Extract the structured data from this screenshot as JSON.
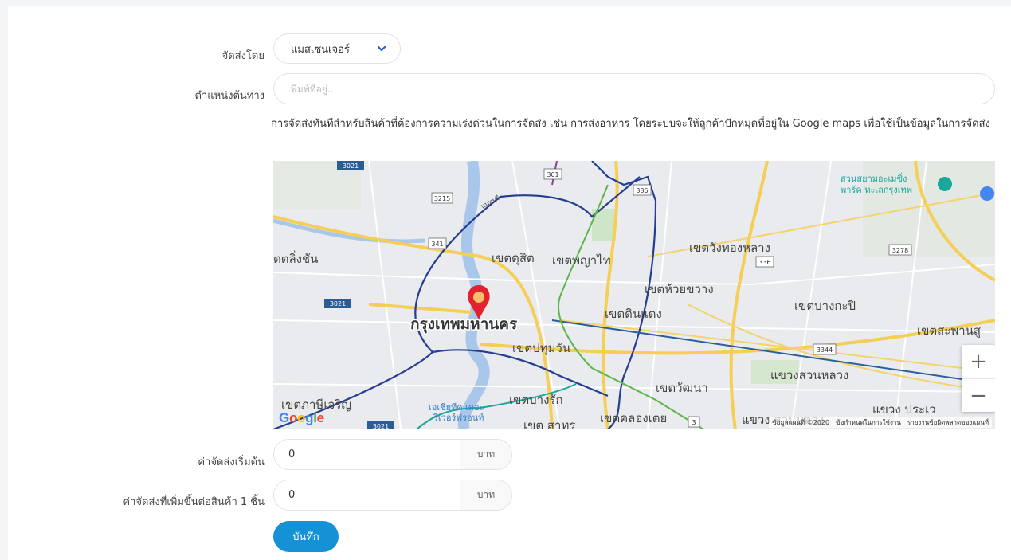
{
  "form": {
    "ship_by_label": "จัดส่งโดย",
    "ship_by_value": "แมสเซนเจอร์",
    "origin_label": "ตำแหน่งต้นทาง",
    "origin_placeholder": "พิมพ์ที่อยู่..",
    "description": "การจัดส่งทันทีสำหรับสินค้าที่ต้องการความเร่งด่วนในการจัดส่ง เช่น การส่งอาหาร โดยระบบจะให้ลูกค้าปักหมุดที่อยู่ใน Google maps เพื่อใช้เป็นข้อมูลในการจัดส่ง",
    "base_fee_label": "ค่าจัดส่งเริ่มต้น",
    "base_fee_value": "0",
    "extra_fee_label": "ค่าจัดส่งที่เพิ่มขึ้นต่อสินค้า 1 ชิ้น",
    "extra_fee_value": "0",
    "unit": "บาท",
    "save_label": "บันทึก"
  },
  "map": {
    "city_label": "กรุงเทพมหานคร",
    "districts": {
      "dusit": "เขตดุสิต",
      "phayathai": "เขตพญาไท",
      "wangthonglang": "เขตวังทองหลาง",
      "huaikhwang": "เขตห้วยขวาง",
      "dindaeng": "เขตดินแดง",
      "bangkapi": "เขตบางกะปิ",
      "pathumwan": "เขตปทุมวัน",
      "saphansung": "เขตสะพานสู",
      "suanluang_a": "แขวงสวนหลวง",
      "watthana": "เขตวัฒนา",
      "bangrak": "เขตบางรัก",
      "khlongtoei": "เขตคลองเตย",
      "sathon": "เขต สาทร",
      "suanluang_b": "แขวง สวนหลวง",
      "prawet": "แขวง ประเว",
      "phasicharoen": "เขตภาษีเจริญ",
      "talingchan": "ตตลิ่งชัน",
      "nonthaburi": "นนทบุรี",
      "siam_amazing": "สวนสยามอะเมซิ่ง",
      "park": "พาร์ค ทะเลกรุงเทพ",
      "iconsiam_1": "เอเชียทีค เดอะ",
      "iconsiam_2": "ริเวอร์ฟรอนท์"
    },
    "road_shields": [
      "3021",
      "3215",
      "301",
      "336",
      "341",
      "3278",
      "336",
      "3021",
      "3344",
      "3021",
      "3"
    ],
    "attribution": {
      "data": "ข้อมูลแผนที่ ©2020",
      "terms": "ข้อกำหนดในการใช้งาน",
      "report": "รายงานข้อผิดพลาดของแผนที่"
    },
    "google_logo": [
      "G",
      "o",
      "o",
      "g",
      "l",
      "e"
    ],
    "zoom_in": "+",
    "zoom_out": "−",
    "colors": {
      "marker": "#e1232f",
      "road_major": "#f5cf55",
      "line_blue": "#253e8f",
      "line_green": "#5cb548",
      "river": "#a9c7ea"
    }
  },
  "colors": {
    "primary_button": "#1592d6",
    "chevron": "#1d5fc2"
  }
}
